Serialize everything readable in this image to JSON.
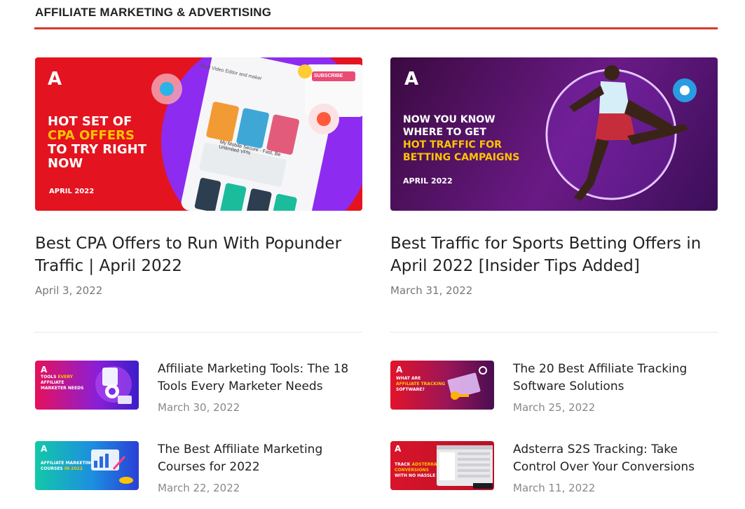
{
  "section": {
    "title": "AFFILIATE MARKETING & ADVERTISING"
  },
  "featured": [
    {
      "title": "Best CPA Offers to Run With Popunder Traffic | April 2022",
      "date": "April 3, 2022",
      "thumb": {
        "line1": "HOT SET OF",
        "line2": "CPA OFFERS",
        "line3": "TO TRY RIGHT",
        "line4": "NOW",
        "tag": "APRIL 2022",
        "ui_caption": "Real Video Editor and maker",
        "ui_subscribe": "SUBSCRIBE",
        "ui_vpn": "My Mobile Secure - Fast, Be Unlimited VPN"
      }
    },
    {
      "title": "Best Traffic for Sports Betting Offers in April 2022 [Insider Tips Added]",
      "date": "March 31, 2022",
      "thumb": {
        "line1": "NOW YOU KNOW",
        "line2": "WHERE TO GET",
        "line3": "HOT TRAFFIC FOR",
        "line4": "BETTING CAMPAIGNS",
        "tag": "APRIL 2022"
      }
    }
  ],
  "posts": [
    {
      "title": "Affiliate Marketing Tools: The 18 Tools Every Marketer Needs",
      "date": "March 30, 2022",
      "thumb": {
        "a": "TOOLS",
        "b": "EVERY",
        "c": "AFFILIATE",
        "d": "MARKETER NEEDS"
      }
    },
    {
      "title": "The 20 Best Affiliate Tracking Software Solutions",
      "date": "March 25, 2022",
      "thumb": {
        "a": "WHAT ARE",
        "b": "AFFILIATE TRACKING",
        "c": "SOFTWARE?"
      }
    },
    {
      "title": "The Best Affiliate Marketing Courses for 2022",
      "date": "March 22, 2022",
      "thumb": {
        "a": "AFFILIATE MARKETING",
        "b": "COURSES",
        "c": "IN 2022"
      }
    },
    {
      "title": "Adsterra S2S Tracking: Take Control Over Your Conversions",
      "date": "March 11, 2022",
      "thumb": {
        "a": "TRACK",
        "b": "ADSTERRA",
        "c": "CONVERSIONS",
        "d": "WITH NO HASSLE"
      }
    }
  ],
  "brand": {
    "logo": "A",
    "accent": "#d63a2e"
  }
}
